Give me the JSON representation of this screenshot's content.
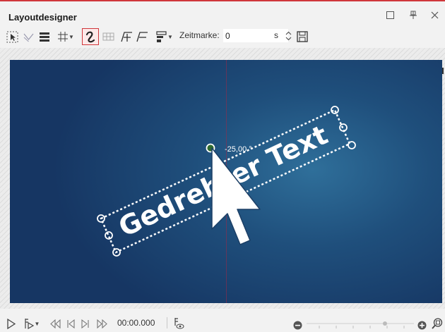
{
  "window": {
    "title": "Layoutdesigner",
    "accent": "#d0373b"
  },
  "window_controls": {
    "maximize_icon": "square-icon",
    "pin_icon": "pin-icon",
    "close_icon": "close-icon"
  },
  "toolbar": {
    "tools": [
      {
        "icon": "select-pointer-icon"
      },
      {
        "icon": "guides-icon"
      },
      {
        "icon": "fill-lines-icon"
      },
      {
        "icon": "grid-icon",
        "dropdown": true
      },
      {
        "icon": "curve-path-icon",
        "active": true
      },
      {
        "icon": "table-icon"
      },
      {
        "icon": "add-keyframe-icon"
      },
      {
        "icon": "remove-keyframe-icon"
      },
      {
        "icon": "align-icon",
        "dropdown": true
      }
    ],
    "timestamp_label": "Zeitmarke:",
    "timestamp_value": "0",
    "timestamp_unit": "s",
    "save_icon": "save-icon"
  },
  "canvas": {
    "text_object": "Gedrehter Text",
    "rotation_label": "-25,00 °",
    "background_colors": [
      "#163663",
      "#2f6f9a"
    ],
    "guide_color": "#a02846",
    "cursor_icon": "arrow-cursor-icon"
  },
  "playback": {
    "timecode": "00:00.000",
    "controls": [
      "play-icon",
      "play-from-mark-icon",
      "first-frame-icon",
      "previous-frame-icon",
      "next-frame-icon",
      "last-frame-icon",
      "preview-icon"
    ],
    "zoom_out_icon": "zoom-out-icon",
    "zoom_in_icon": "zoom-in-icon",
    "fit_zoom_icon": "zoom-fit-icon",
    "zoom_level": 0.73
  }
}
